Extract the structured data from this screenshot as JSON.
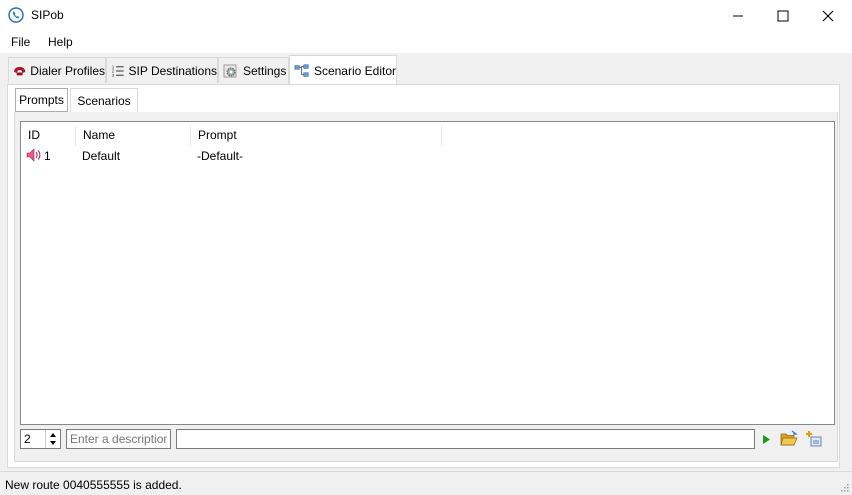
{
  "window": {
    "title": "SIPob",
    "icon": "phone-icon",
    "controls": [
      "minimize-icon",
      "maximize-icon",
      "close-icon"
    ]
  },
  "menu": [
    "File",
    "Help"
  ],
  "tabs": [
    {
      "label": "Dialer Profiles",
      "icon": "phone-handset-icon"
    },
    {
      "label": "SIP Destinations",
      "icon": "numbered-list-icon"
    },
    {
      "label": "Settings",
      "icon": "gear-icon"
    },
    {
      "label": "Scenario Editor",
      "icon": "flowchart-icon"
    }
  ],
  "active_tab": "Scenario Editor",
  "subtabs": [
    {
      "label": "Prompts"
    },
    {
      "label": "Scenarios"
    }
  ],
  "active_subtab": "Prompts",
  "list": {
    "columns": [
      "ID",
      "Name",
      "Prompt"
    ],
    "rows": [
      {
        "id": "1",
        "name": "Default",
        "prompt": "-Default-",
        "icon": "speaker-icon"
      }
    ]
  },
  "editor": {
    "id_value": "2",
    "description_placeholder": "Enter a description",
    "prompt_value": ""
  },
  "status": {
    "text": "New route 0040555555 is added."
  },
  "colors": {
    "accent": "#0078d7",
    "play_green": "#1a9a1a",
    "folder_yellow": "#e8b830"
  }
}
